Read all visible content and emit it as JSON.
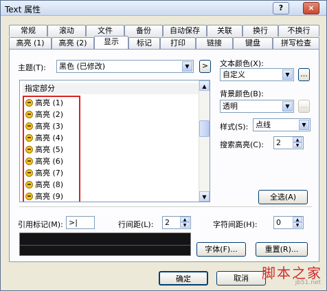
{
  "window": {
    "title": "Text 属性",
    "help_label": "?",
    "close_label": "×"
  },
  "tabs_row1": [
    "常规",
    "滚动",
    "文件",
    "备份",
    "自动保存",
    "关联",
    "换行",
    "不换行"
  ],
  "tabs_row2": [
    "高亮 (1)",
    "高亮 (2)",
    "显示",
    "标记",
    "打印",
    "链接",
    "键盘",
    "拼写检查"
  ],
  "active_tab": "显示",
  "theme": {
    "label": "主题(T):",
    "value": "黑色 (已修改)",
    "next_label": ">"
  },
  "list": {
    "header": "指定部分",
    "items": [
      "高亮 (1)",
      "高亮 (2)",
      "高亮 (3)",
      "高亮 (4)",
      "高亮 (5)",
      "高亮 (6)",
      "高亮 (7)",
      "高亮 (8)",
      "高亮 (9)"
    ]
  },
  "text_color": {
    "label": "文本颜色(X):",
    "value": "自定义",
    "more_label": "..."
  },
  "bg_color": {
    "label": "背景颜色(B):",
    "value": "透明",
    "more_label": "..."
  },
  "style": {
    "label": "样式(S):",
    "value": "点线"
  },
  "search_highlight": {
    "label": "搜索高亮(C):",
    "value": "2"
  },
  "select_all_label": "全选(A)",
  "ref_mark": {
    "label": "引用标记(M):",
    "value": ">|"
  },
  "line_spacing": {
    "label": "行间距(L):",
    "value": "2"
  },
  "char_spacing": {
    "label": "字符间距(H):",
    "value": "0"
  },
  "font_button": "字体(F)...",
  "reset_button": "重置(R)...",
  "ok_button": "确定",
  "cancel_button": "取消",
  "watermark": {
    "title": "脚本之家",
    "url": "jb51.net"
  },
  "colors": {
    "preview_bg": "#141414",
    "highlight_border": "#d82020",
    "accent": "#003c74"
  }
}
